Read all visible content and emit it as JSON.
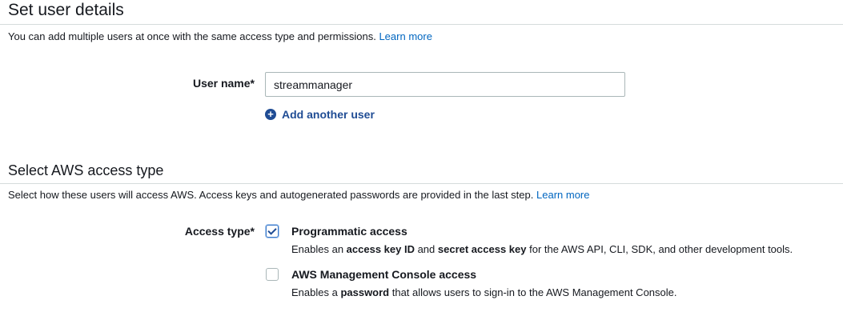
{
  "user_details": {
    "title": "Set user details",
    "description": "You can add multiple users at once with the same access type and permissions.",
    "learn_more": "Learn more",
    "user_name_label": "User name*",
    "user_name_value": "streammanager",
    "add_user_label": "Add another user"
  },
  "access_type": {
    "title": "Select AWS access type",
    "description": "Select how these users will access AWS. Access keys and autogenerated passwords are provided in the last step.",
    "learn_more": "Learn more",
    "label": "Access type*",
    "options": [
      {
        "title": "Programmatic access",
        "checked": true,
        "desc_parts": [
          "Enables an ",
          "access key ID",
          " and ",
          "secret access key",
          " for the AWS API, CLI, SDK, and other development tools."
        ]
      },
      {
        "title": "AWS Management Console access",
        "checked": false,
        "desc_parts": [
          "Enables a ",
          "password",
          " that allows users to sign-in to the AWS Management Console."
        ]
      }
    ]
  },
  "colors": {
    "link": "#0066c0",
    "add_link": "#1f4c94",
    "checkbox_check": "#1f4c94",
    "rule": "#d5dbdb"
  }
}
